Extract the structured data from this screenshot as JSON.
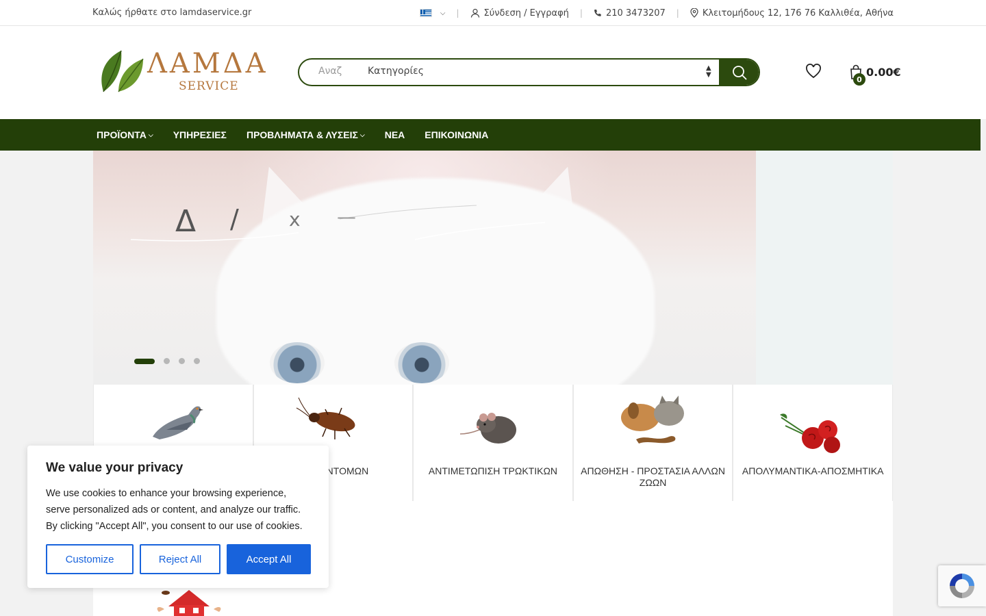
{
  "topbar": {
    "welcome": "Καλώς ήρθατε στο lamdaservice.gr",
    "login": "Σύνδεση / Εγγραφή",
    "phone": "210 3473207",
    "address": "Κλειτομήδους 12, 176 76 Καλλιθέα, Αθήνα"
  },
  "header": {
    "logo_line1": "ΛΑΜΔΑ",
    "logo_line2": "SERVICE",
    "search_placeholder": "Αναζήτηση",
    "search_visible": "Αναζ",
    "category_select": "Κατηγορίες",
    "cart_count": "0",
    "cart_total": "0.00€"
  },
  "nav": {
    "items": [
      {
        "label": "ΠΡΟΪΟΝΤΑ",
        "dropdown": true
      },
      {
        "label": "ΥΠΗΡΕΣΙΕΣ",
        "dropdown": false
      },
      {
        "label": "ΠΡΟΒΛΗΜΑΤΑ & ΛΥΣΕΙΣ",
        "dropdown": true
      },
      {
        "label": "ΝΕΑ",
        "dropdown": false
      },
      {
        "label": "ΕΠΙΚΟΙΝΩΝΙΑ",
        "dropdown": false
      }
    ]
  },
  "hero": {
    "glyphs": [
      "Δ",
      "/",
      "x",
      "—"
    ],
    "slides": 4,
    "active_slide": 1
  },
  "categories": [
    {
      "label": "",
      "icon": "pigeon-icon"
    },
    {
      "label": "ΗΣΗ ΕΝΤΟΜΩΝ",
      "icon": "cockroach-icon"
    },
    {
      "label": "ΑΝΤΙΜΕΤΩΠΙΣΗ ΤΡΩΚΤΙΚΩΝ",
      "icon": "rat-icon"
    },
    {
      "label": "ΑΠΩΘΗΣΗ - ΠΡΟΣΤΑΣΙΑ ΑΛΛΩΝ ΖΩΩΝ",
      "icon": "pets-icon"
    },
    {
      "label": "ΑΠΟΛΥΜΑΝΤΙΚΑ-ΑΠΟΣΜΗΤΙΚΑ",
      "icon": "roses-icon"
    }
  ],
  "cookie": {
    "title": "We value your privacy",
    "text": "We use cookies to enhance your browsing experience, serve personalized ads or content, and analyze our traffic. By clicking \"Accept All\", you consent to our use of cookies.",
    "customize": "Customize",
    "reject": "Reject All",
    "accept": "Accept All"
  },
  "colors": {
    "brand_green": "#233f08",
    "logo_brown": "#b5773d",
    "cookie_blue": "#1863dc"
  }
}
